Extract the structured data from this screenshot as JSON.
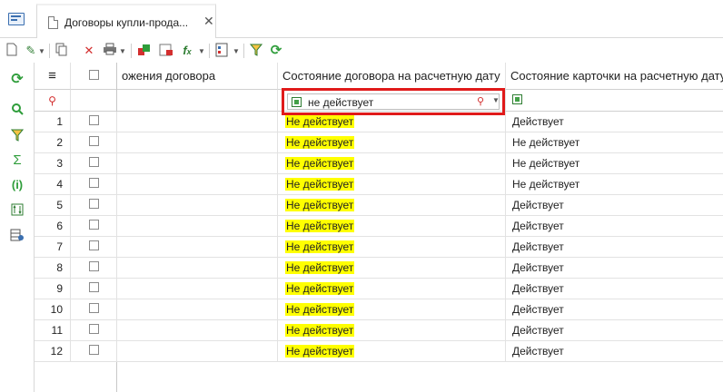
{
  "tab": {
    "title": "Договоры купли-прода..."
  },
  "columns": {
    "partial_header": "ожения договора",
    "state_contract": "Состояние договора на расчетную дату",
    "state_card": "Состояние карточки на расчетную дату"
  },
  "filter": {
    "value": "не действует"
  },
  "rows": [
    {
      "n": "1",
      "contract": "Не действует",
      "card": "Действует"
    },
    {
      "n": "2",
      "contract": "Не действует",
      "card": "Не действует"
    },
    {
      "n": "3",
      "contract": "Не действует",
      "card": "Не действует"
    },
    {
      "n": "4",
      "contract": "Не действует",
      "card": "Не действует"
    },
    {
      "n": "5",
      "contract": "Не действует",
      "card": "Действует"
    },
    {
      "n": "6",
      "contract": "Не действует",
      "card": "Действует"
    },
    {
      "n": "7",
      "contract": "Не действует",
      "card": "Действует"
    },
    {
      "n": "8",
      "contract": "Не действует",
      "card": "Действует"
    },
    {
      "n": "9",
      "contract": "Не действует",
      "card": "Действует"
    },
    {
      "n": "10",
      "contract": "Не действует",
      "card": "Действует"
    },
    {
      "n": "11",
      "contract": "Не действует",
      "card": "Действует"
    },
    {
      "n": "12",
      "contract": "Не действует",
      "card": "Действует"
    }
  ],
  "colors": {
    "highlight": "#ffff00",
    "filter_border": "#e01a1a",
    "accent_green": "#2e9d3a",
    "icon_blue": "#3b6fb0"
  },
  "icons": {
    "toolbar": [
      "new-document-icon",
      "edit-icon",
      "copy-icon",
      "delete-icon",
      "print-icon",
      "export-icon",
      "report-icon",
      "function-icon",
      "attachments-icon",
      "filter-icon",
      "refresh-icon"
    ],
    "sidebar": [
      "refresh-icon",
      "zoom-icon",
      "filter-icon",
      "sum-icon",
      "info-icon",
      "sort-icon",
      "settings-grid-icon"
    ]
  }
}
